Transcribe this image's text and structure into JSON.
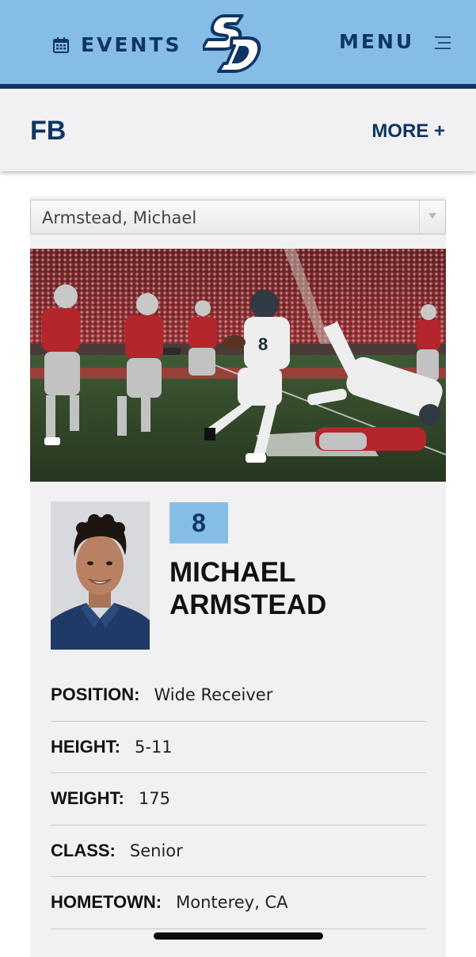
{
  "header": {
    "events_label": "EVENTS",
    "menu_label": "MENU",
    "logo_text": "SD",
    "background_color": "#86bde6",
    "accent_color": "#0e3563"
  },
  "subheader": {
    "sport_title": "FB",
    "more_label": "MORE +"
  },
  "player_select": {
    "selected": "Armstead, Michael"
  },
  "player": {
    "jersey_number": "8",
    "first_name": "MICHAEL",
    "last_name": "ARMSTEAD"
  },
  "bio": [
    {
      "label": "POSITION:",
      "value": "Wide Receiver"
    },
    {
      "label": "HEIGHT:",
      "value": "5-11"
    },
    {
      "label": "WEIGHT:",
      "value": "175"
    },
    {
      "label": "CLASS:",
      "value": "Senior"
    },
    {
      "label": "HOMETOWN:",
      "value": "Monterey, CA"
    }
  ],
  "icons": {
    "events": "calendar-icon",
    "menu": "hamburger-icon",
    "select": "chevron-down-icon"
  }
}
